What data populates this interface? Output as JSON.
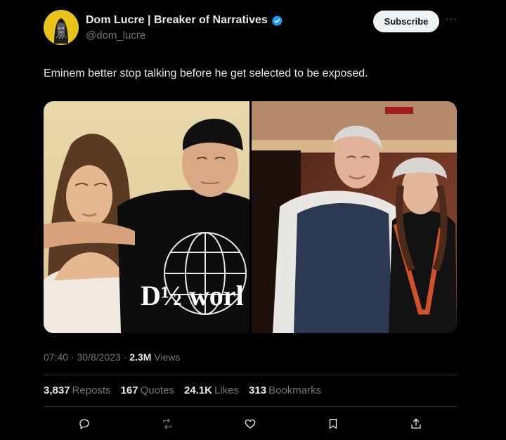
{
  "author": {
    "display_name": "Dom Lucre | Breaker of Narratives",
    "handle": "@dom_lucre",
    "verified": true
  },
  "subscribe_label": "Subscribe",
  "more_label": "···",
  "tweet_text": "Eminem better stop talking before he get selected to be exposed.",
  "media": {
    "left_photo_text": "D½ worl"
  },
  "meta": {
    "time": "07:40",
    "date": "30/8/2023",
    "views_count": "2.3M",
    "views_label": "Views"
  },
  "stats": {
    "reposts_count": "3,837",
    "reposts_label": "Reposts",
    "quotes_count": "167",
    "quotes_label": "Quotes",
    "likes_count": "24.1K",
    "likes_label": "Likes",
    "bookmarks_count": "313",
    "bookmarks_label": "Bookmarks"
  },
  "actions": [
    "reply-icon",
    "repost-icon",
    "like-icon",
    "bookmark-icon",
    "share-icon"
  ],
  "colors": {
    "background": "#000000",
    "text": "#e7e9ea",
    "muted": "#71767b",
    "verified": "#1d9bf0",
    "divider": "#2f3336"
  }
}
